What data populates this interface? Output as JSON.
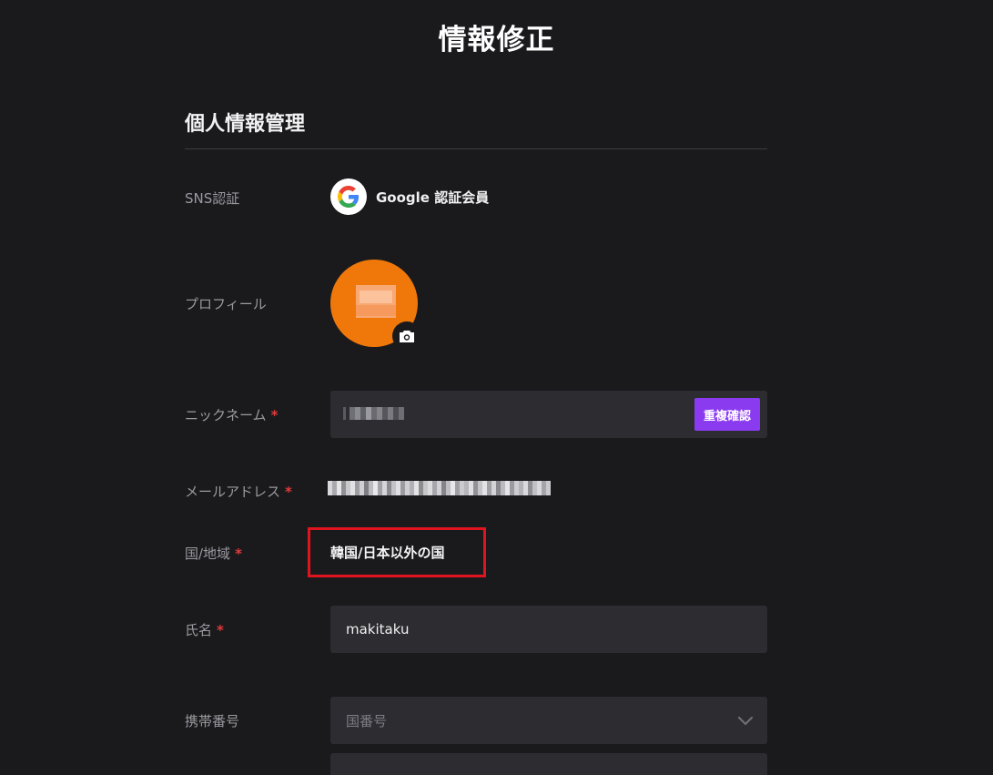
{
  "page": {
    "title": "情報修正"
  },
  "section": {
    "title": "個人情報管理"
  },
  "sns": {
    "label": "SNS認証",
    "value": "Google 認証会員",
    "icon": "google-icon"
  },
  "profile": {
    "label": "プロフィール",
    "avatar_color": "#f0780a",
    "camera_icon": "camera-icon"
  },
  "nickname": {
    "label": "ニックネーム",
    "required_mark": "*",
    "button_label": "重複確認",
    "button_color": "#8a3bf0"
  },
  "email": {
    "label": "メールアドレス",
    "required_mark": "*"
  },
  "country": {
    "label": "国/地域",
    "required_mark": "*",
    "value": "韓国/日本以外の国",
    "highlight_color": "#e0141e"
  },
  "name": {
    "label": "氏名",
    "required_mark": "*",
    "value": "makitaku"
  },
  "phone": {
    "label": "携帯番号",
    "country_code_placeholder": "国番号",
    "dropdown_icon": "chevron-down-icon"
  }
}
